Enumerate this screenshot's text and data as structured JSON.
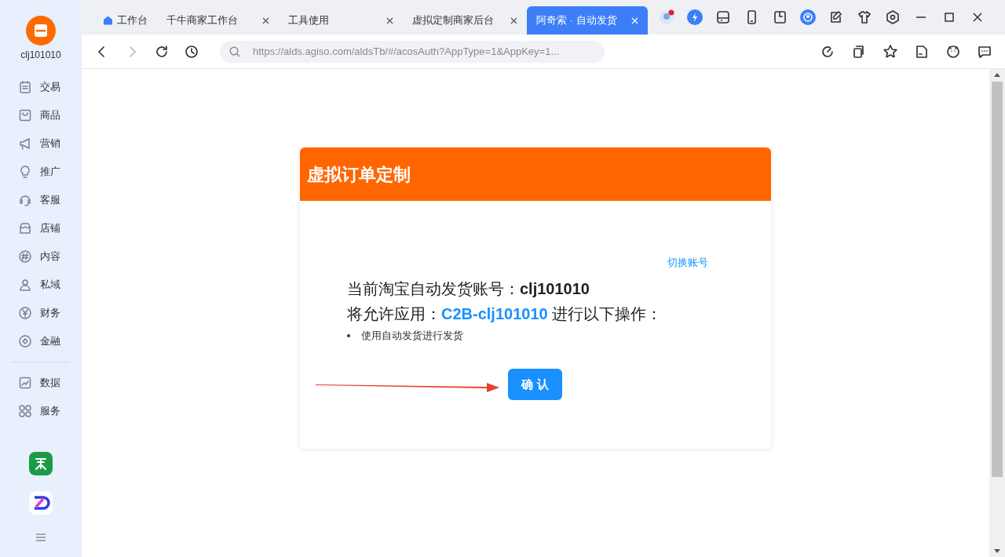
{
  "sidebar": {
    "account": "clj101010",
    "groups": [
      [
        {
          "label": "交易"
        },
        {
          "label": "商品"
        },
        {
          "label": "营销"
        },
        {
          "label": "推广"
        },
        {
          "label": "客服"
        },
        {
          "label": "店铺"
        },
        {
          "label": "内容"
        },
        {
          "label": "私域"
        },
        {
          "label": "财务"
        },
        {
          "label": "金融"
        }
      ],
      [
        {
          "label": "数据"
        },
        {
          "label": "服务"
        }
      ]
    ]
  },
  "tabs": [
    {
      "kind": "home",
      "label": "工作台",
      "selected": false
    },
    {
      "kind": "page",
      "label": "千牛商家工作台",
      "selected": false
    },
    {
      "kind": "page",
      "label": "工具使用",
      "selected": false
    },
    {
      "kind": "page",
      "label": "虚拟定制商家后台",
      "selected": false
    },
    {
      "kind": "page",
      "label": "阿奇索 · 自动发货",
      "selected": true
    }
  ],
  "address_bar": {
    "url": "https://alds.agiso.com/aldsTb/#/acosAuth?AppType=1&AppKey=1..."
  },
  "card": {
    "title": "虚拟订单定制",
    "switch_link": "切换账号",
    "account_line": "当前淘宝自动发货账号：**clj101010**",
    "permission_line": "将允许应用：**C2B-clj101010** 进行以下操作：",
    "permissions": [
      "使用自动发货进行发货"
    ],
    "confirm_button": "确 认"
  }
}
